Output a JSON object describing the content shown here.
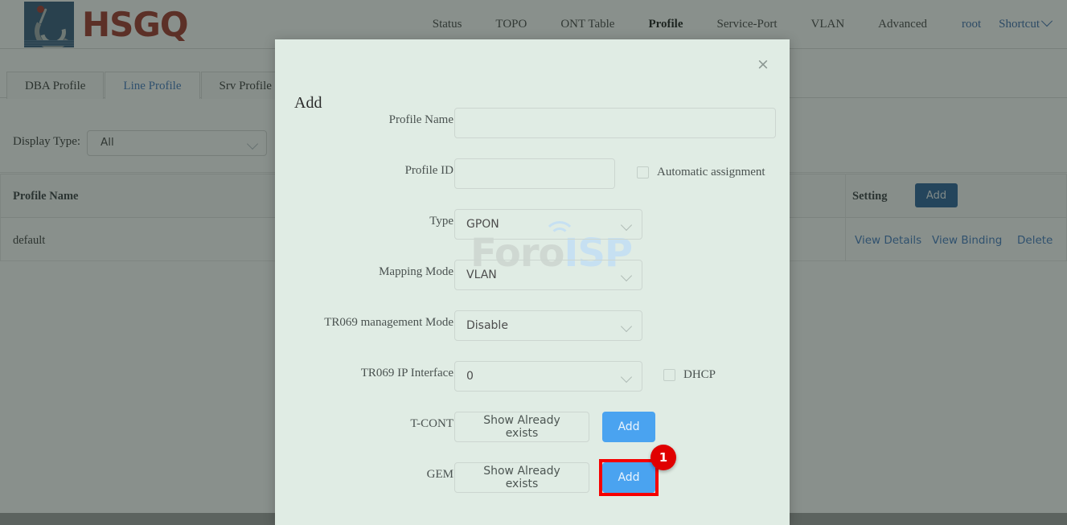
{
  "header": {
    "logo_text": "HSGQ",
    "nav_items": [
      {
        "label": "Status",
        "active": false
      },
      {
        "label": "TOPO",
        "active": false
      },
      {
        "label": "ONT Table",
        "active": false
      },
      {
        "label": "Profile",
        "active": true
      },
      {
        "label": "Service-Port",
        "active": false
      },
      {
        "label": "VLAN",
        "active": false
      },
      {
        "label": "Advanced",
        "active": false
      }
    ],
    "user": "root",
    "shortcut": "Shortcut"
  },
  "tabs": [
    {
      "label": "DBA Profile",
      "active": false
    },
    {
      "label": "Line Profile",
      "active": true
    },
    {
      "label": "Srv Profile",
      "active": false
    },
    {
      "label": "",
      "active": false
    }
  ],
  "filter": {
    "label": "Display Type:",
    "value": "All"
  },
  "table": {
    "columns": [
      "Profile Name",
      "Setting"
    ],
    "add_label": "Add",
    "rows": [
      {
        "profile_name": "default",
        "actions": [
          "View Details",
          "View Binding",
          "Delete"
        ]
      }
    ]
  },
  "modal": {
    "title": "Add",
    "close_icon": "×",
    "watermark_foro": "Foro",
    "watermark_isp": "ISP",
    "fields": {
      "profile_name": {
        "label": "Profile Name",
        "value": "",
        "placeholder": ""
      },
      "profile_id": {
        "label": "Profile ID",
        "value": "",
        "placeholder": ""
      },
      "automatic_assignment": {
        "label": "Automatic assignment",
        "checked": false
      },
      "type": {
        "label": "Type",
        "value": "GPON"
      },
      "mapping_mode": {
        "label": "Mapping Mode",
        "value": "VLAN"
      },
      "tr069_management_mode": {
        "label": "TR069 management Mode",
        "value": "Disable"
      },
      "tr069_ip_interface": {
        "label": "TR069 IP Interface",
        "value": "0"
      },
      "dhcp": {
        "label": "DHCP",
        "checked": false
      },
      "tcont": {
        "label": "T-CONT",
        "show_label": "Show Already exists",
        "add_label": "Add"
      },
      "gem": {
        "label": "GEM",
        "show_label": "Show Already exists",
        "add_label": "Add"
      }
    }
  },
  "annotation": {
    "badge_number": "1",
    "highlight_color": "#f50000"
  }
}
